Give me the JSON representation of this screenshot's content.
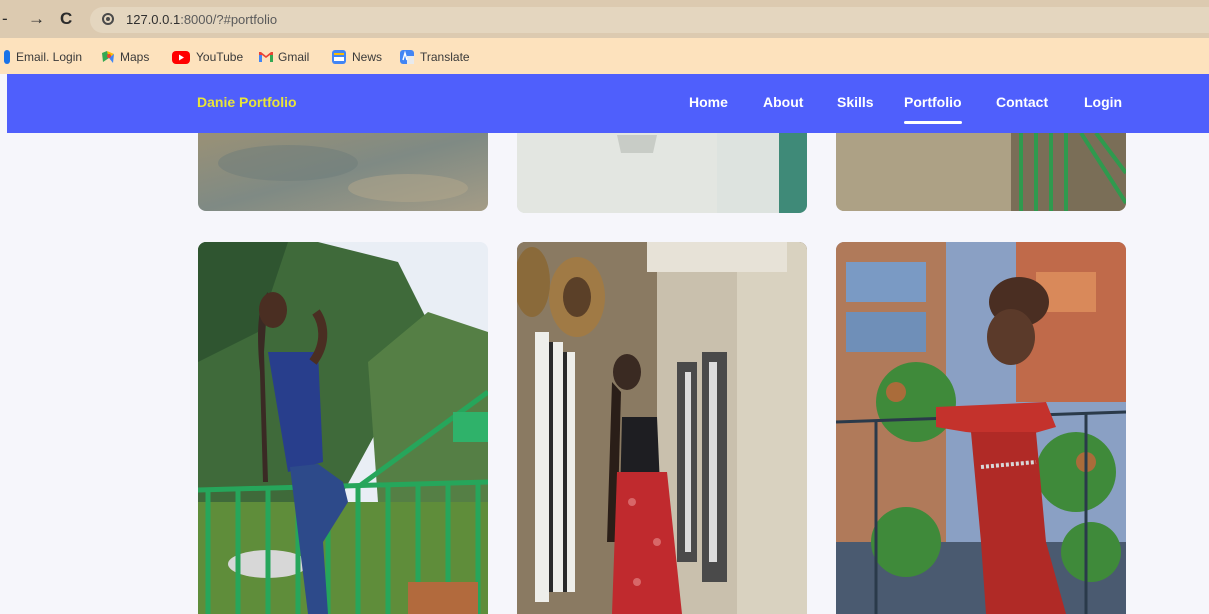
{
  "browser": {
    "url_host": "127.0.0.1",
    "url_rest": ":8000/?#portfolio",
    "bookmarks": [
      {
        "label": "Email. Login",
        "icon": "bookmark-icon",
        "color": "#1a73e8"
      },
      {
        "label": "Maps",
        "icon": "maps-icon",
        "color": "#34a853"
      },
      {
        "label": "YouTube",
        "icon": "youtube-icon",
        "color": "#ff0000"
      },
      {
        "label": "Gmail",
        "icon": "gmail-icon",
        "color": "#ea4335"
      },
      {
        "label": "News",
        "icon": "news-icon",
        "color": "#4285f4"
      },
      {
        "label": "Translate",
        "icon": "translate-icon",
        "color": "#4285f4"
      }
    ]
  },
  "site": {
    "brand": "Danie Portfolio",
    "brand_color": "#e8e43a",
    "nav_color": "#4f5ffc",
    "nav": [
      {
        "label": "Home"
      },
      {
        "label": "About"
      },
      {
        "label": "Skills"
      },
      {
        "label": "Portfolio",
        "active": true
      },
      {
        "label": "Contact"
      },
      {
        "label": "Login"
      }
    ]
  },
  "portfolio": {
    "images": [
      {
        "alt": "portfolio-photo-1"
      },
      {
        "alt": "portfolio-photo-2"
      },
      {
        "alt": "portfolio-photo-3"
      },
      {
        "alt": "portfolio-photo-4"
      },
      {
        "alt": "portfolio-photo-5"
      },
      {
        "alt": "portfolio-photo-6"
      }
    ]
  }
}
